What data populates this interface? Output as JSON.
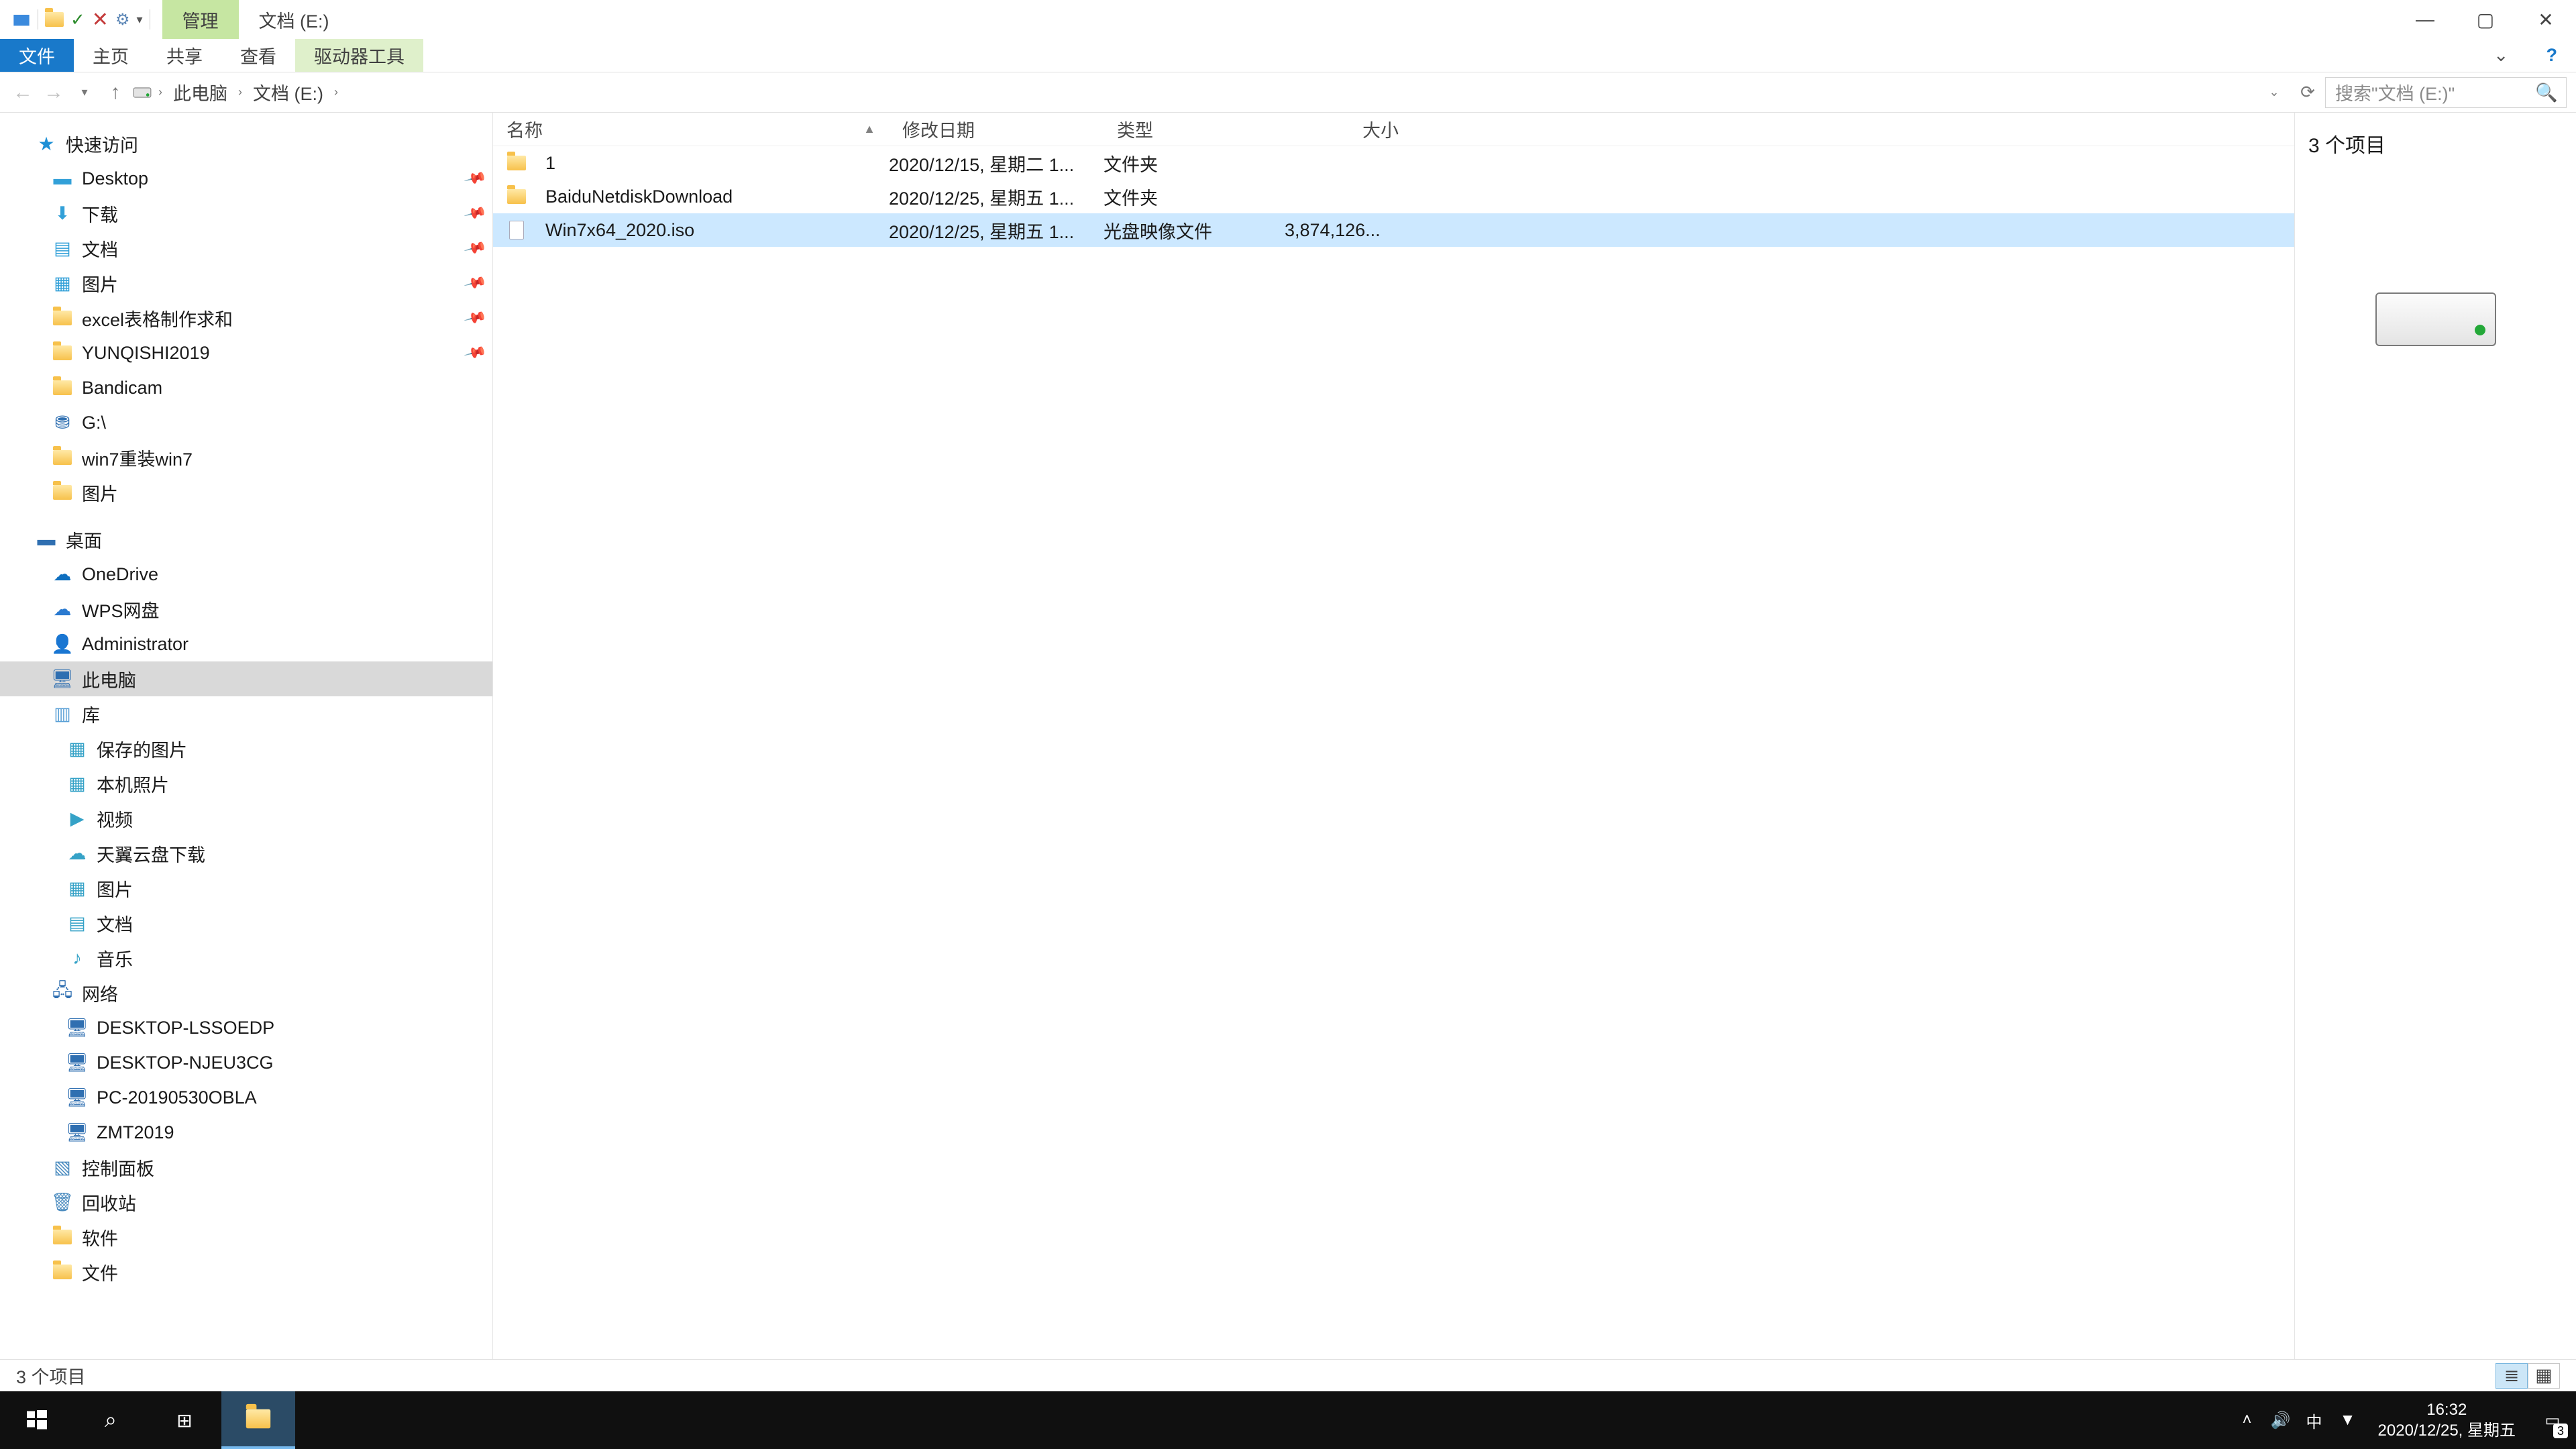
{
  "titlebar": {
    "context_tab": "管理",
    "title": "文档 (E:)"
  },
  "ribbon": {
    "file": "文件",
    "home": "主页",
    "share": "共享",
    "view": "查看",
    "drive_tools": "驱动器工具"
  },
  "nav": {
    "crumbs": [
      "此电脑",
      "文档 (E:)"
    ],
    "search_placeholder": "搜索\"文档 (E:)\""
  },
  "tree": {
    "quick_access": "快速访问",
    "pinned": [
      {
        "label": "Desktop"
      },
      {
        "label": "下载"
      },
      {
        "label": "文档"
      },
      {
        "label": "图片"
      },
      {
        "label": "excel表格制作求和"
      },
      {
        "label": "YUNQISHI2019"
      },
      {
        "label": "Bandicam"
      },
      {
        "label": "G:\\"
      },
      {
        "label": "win7重装win7"
      },
      {
        "label": "图片"
      }
    ],
    "desktop": "桌面",
    "desktop_children": [
      "OneDrive",
      "WPS网盘",
      "Administrator",
      "此电脑",
      "库"
    ],
    "libraries_children": [
      "保存的图片",
      "本机照片",
      "视频",
      "天翼云盘下载",
      "图片",
      "文档",
      "音乐"
    ],
    "network": "网络",
    "network_children": [
      "DESKTOP-LSSOEDP",
      "DESKTOP-NJEU3CG",
      "PC-20190530OBLA",
      "ZMT2019"
    ],
    "bottom": [
      "控制面板",
      "回收站",
      "软件",
      "文件"
    ]
  },
  "columns": {
    "name": "名称",
    "date": "修改日期",
    "type": "类型",
    "size": "大小"
  },
  "files": [
    {
      "name": "1",
      "date": "2020/12/15, 星期二 1...",
      "type": "文件夹",
      "size": "",
      "icon": "folder"
    },
    {
      "name": "BaiduNetdiskDownload",
      "date": "2020/12/25, 星期五 1...",
      "type": "文件夹",
      "size": "",
      "icon": "folder"
    },
    {
      "name": "Win7x64_2020.iso",
      "date": "2020/12/25, 星期五 1...",
      "type": "光盘映像文件",
      "size": "3,874,126...",
      "icon": "file",
      "selected": true
    }
  ],
  "preview": {
    "count_label": "3 个项目"
  },
  "statusbar": {
    "text": "3 个项目"
  },
  "taskbar": {
    "time": "16:32",
    "date": "2020/12/25, 星期五",
    "notif_count": "3"
  }
}
